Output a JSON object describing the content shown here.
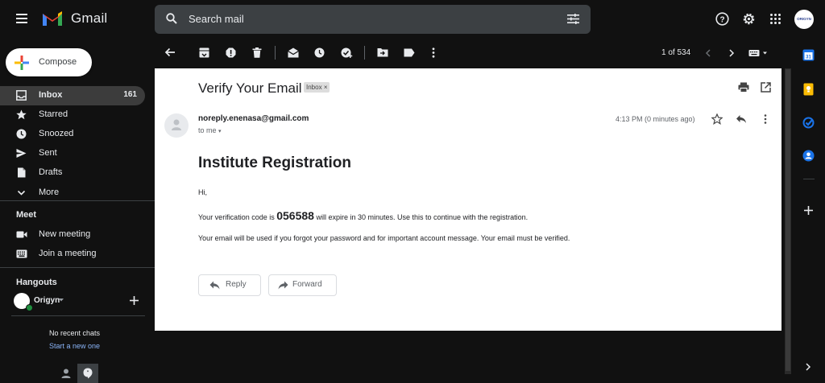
{
  "app": {
    "brand": "Gmail"
  },
  "search": {
    "placeholder": "Search mail"
  },
  "account": {
    "avatar_text": "ORIGYN"
  },
  "compose_label": "Compose",
  "nav": [
    {
      "label": "Inbox",
      "count": "161",
      "icon": "inbox-icon"
    },
    {
      "label": "Starred",
      "icon": "star-icon"
    },
    {
      "label": "Snoozed",
      "icon": "clock-icon"
    },
    {
      "label": "Sent",
      "icon": "send-icon"
    },
    {
      "label": "Drafts",
      "icon": "draft-icon"
    },
    {
      "label": "More",
      "icon": "chevron-down-icon"
    }
  ],
  "meet": {
    "title": "Meet",
    "items": [
      {
        "label": "New meeting",
        "icon": "video-icon"
      },
      {
        "label": "Join a meeting",
        "icon": "keyboard-icon"
      }
    ]
  },
  "hangouts": {
    "title": "Hangouts",
    "user": "Origyn",
    "empty_text": "No recent chats",
    "start_link": "Start a new one"
  },
  "pager": {
    "text": "1 of 534"
  },
  "message": {
    "subject": "Verify Your Email",
    "label_badge": "Inbox",
    "sender": "noreply.enenasa@gmail.com",
    "to": "to me",
    "time": "4:13 PM (0 minutes ago)",
    "heading": "Institute Registration",
    "greeting": "Hi,",
    "code_pre": "Your verification code is ",
    "code": "056588",
    "code_post": " will expire in 30 minutes. Use this to continue with the registration.",
    "notice": "Your email will be used if you forgot your password and for important account message. Your email must be verified.",
    "reply_label": "Reply",
    "forward_label": "Forward"
  },
  "colors": {
    "background": "#111111",
    "card": "#ffffff",
    "active_nav": "#3c3c3c",
    "link": "#8ab4f8"
  }
}
